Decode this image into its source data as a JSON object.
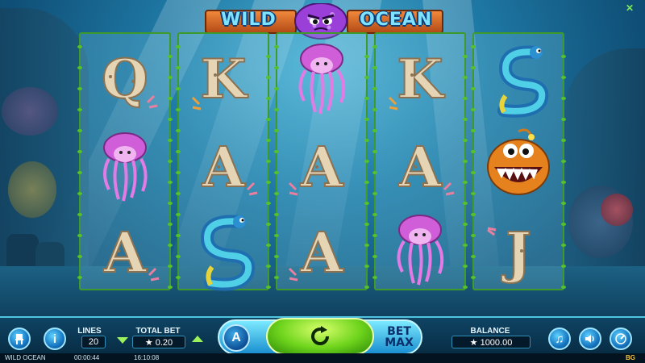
{
  "game": {
    "logo_word_1": "WILD",
    "logo_word_2": "OCEAN"
  },
  "reels": [
    [
      "Q",
      "jellyfish",
      "A"
    ],
    [
      "K",
      "A",
      "eel"
    ],
    [
      "jellyfish",
      "A",
      "A"
    ],
    [
      "K",
      "A",
      "jellyfish"
    ],
    [
      "eel",
      "anglerfish",
      "J"
    ]
  ],
  "controls": {
    "lines_label": "LINES",
    "lines_value": "20",
    "total_bet_label": "TOTAL BET",
    "total_bet_value": "★ 0.20",
    "auto_label": "A",
    "bet_max_line1": "BET",
    "bet_max_line2": "MAX",
    "balance_label": "BALANCE",
    "balance_value": "★ 1000.00",
    "info_label": "i"
  },
  "status": {
    "game_name": "WILD OCEAN",
    "session_time": "00:00:44",
    "clock": "16:10:08",
    "provider": "BG"
  },
  "colors": {
    "frame_vine": "#3e9a2a",
    "spin_green": "#6ed41c",
    "panel_blue": "#04192a"
  }
}
